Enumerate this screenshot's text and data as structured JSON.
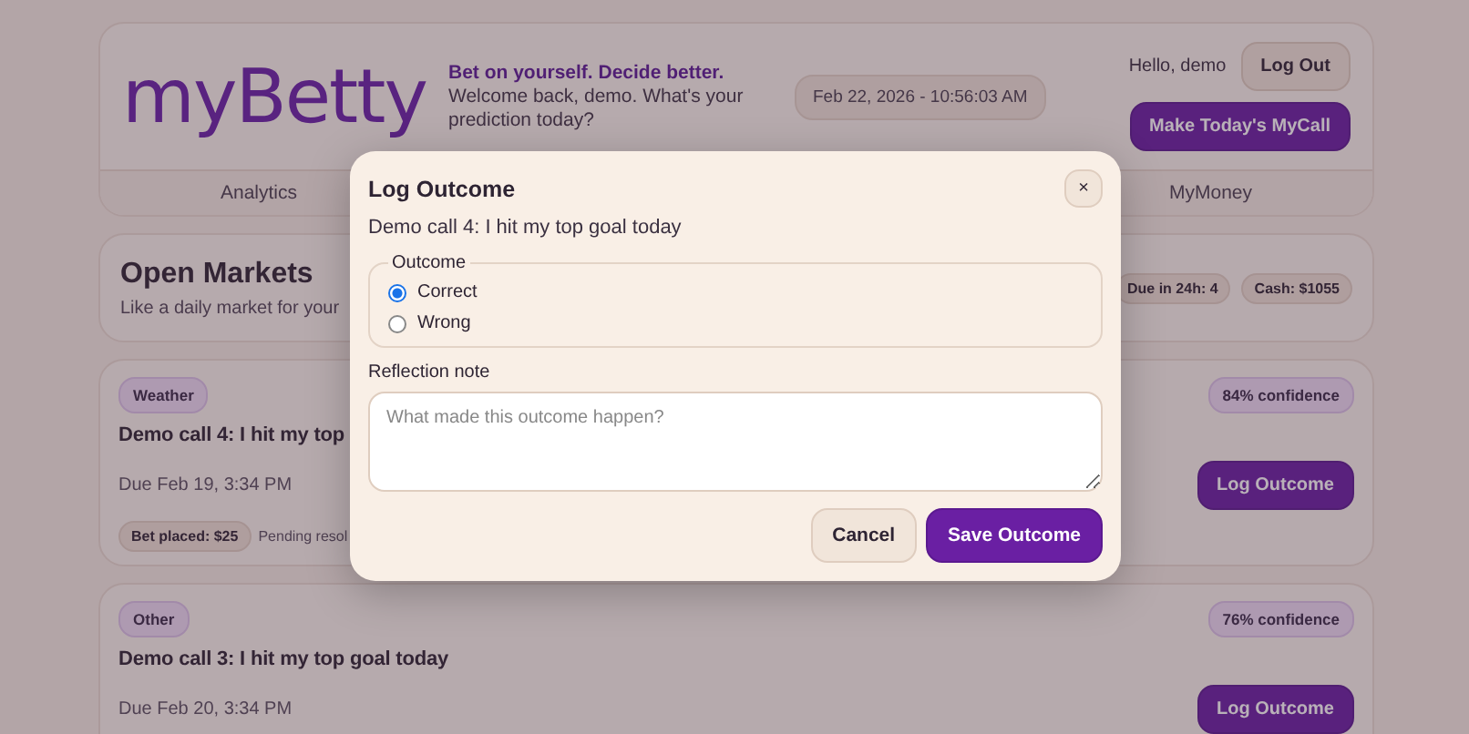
{
  "header": {
    "logo": "myBetty",
    "tagline": "Bet on yourself. Decide better.",
    "welcome": "Welcome back, demo. What's your prediction today?",
    "datetime": "Feb 22, 2026 - 10:56:03 AM",
    "greeting": "Hello, demo",
    "logout": "Log Out",
    "make_call": "Make Today's MyCall"
  },
  "nav": [
    {
      "label": "Analytics"
    },
    {
      "label": "MyMoney"
    }
  ],
  "open_markets": {
    "title": "Open Markets",
    "subtitle": "Like a daily market for your",
    "badges": [
      "Due in 24h: 4",
      "Cash: $1055"
    ]
  },
  "markets": [
    {
      "category": "Weather",
      "confidence": "84% confidence",
      "title": "Demo call 4: I hit my top",
      "due": "Due Feb 19, 3:34 PM",
      "bet": "Bet placed: $25",
      "status": "Pending resol",
      "action": "Log Outcome"
    },
    {
      "category": "Other",
      "confidence": "76% confidence",
      "title": "Demo call 3: I hit my top goal today",
      "due": "Due Feb 20, 3:34 PM",
      "action": "Log Outcome"
    }
  ],
  "modal": {
    "title": "Log Outcome",
    "close": "×",
    "call": "Demo call 4: I hit my top goal today",
    "legend": "Outcome",
    "options": [
      {
        "label": "Correct",
        "selected": true
      },
      {
        "label": "Wrong",
        "selected": false
      }
    ],
    "note_label": "Reflection note",
    "placeholder": "What made this outcome happen?",
    "cancel": "Cancel",
    "save": "Save Outcome"
  }
}
